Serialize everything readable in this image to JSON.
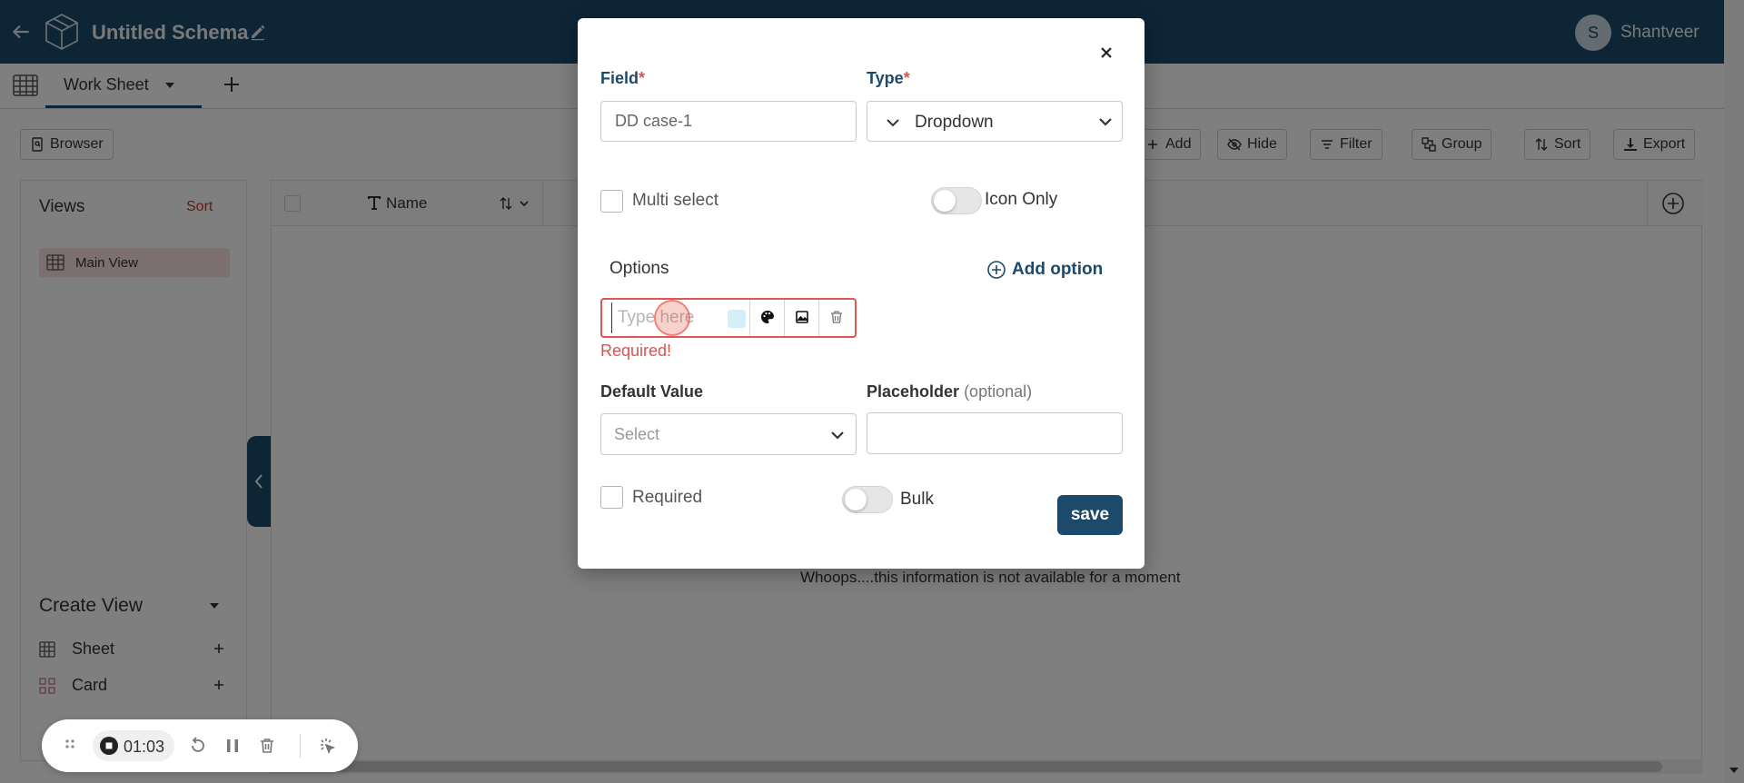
{
  "header": {
    "schema_title": "Untitled Schema",
    "user_initial": "S",
    "user_name": "Shantveer"
  },
  "tabs": {
    "active_tab": "Work Sheet"
  },
  "toolbar": {
    "browser": "Browser",
    "add": "Add",
    "hide": "Hide",
    "filter": "Filter",
    "group": "Group",
    "sort": "Sort",
    "export": "Export"
  },
  "sidebar": {
    "views_title": "Views",
    "sort_label": "Sort",
    "main_view": "Main View",
    "create_view_title": "Create View",
    "create_items": [
      "Sheet",
      "Card"
    ]
  },
  "grid": {
    "column_name": "Name",
    "empty_message": "Whoops....this information is not available for a moment"
  },
  "modal": {
    "field_label": "Field",
    "field_value": "DD case-1",
    "type_label": "Type",
    "type_value": "Dropdown",
    "multi_select_label": "Multi select",
    "icon_only_label": "Icon Only",
    "options_title": "Options",
    "add_option_label": "Add option",
    "option_placeholder": "Type here",
    "required_error": "Required!",
    "default_value_label": "Default Value",
    "default_value_placeholder": "Select",
    "placeholder_label": "Placeholder",
    "placeholder_optional": "(optional)",
    "required_label": "Required",
    "bulk_label": "Bulk",
    "save_label": "save",
    "required_marker": "*"
  },
  "recorder": {
    "elapsed": "01:03"
  },
  "colors": {
    "brand": "#1d4a6b",
    "error": "#d9534f",
    "selected_view_bg": "#f6dfe0",
    "option_swatch": "#d6eefb"
  }
}
